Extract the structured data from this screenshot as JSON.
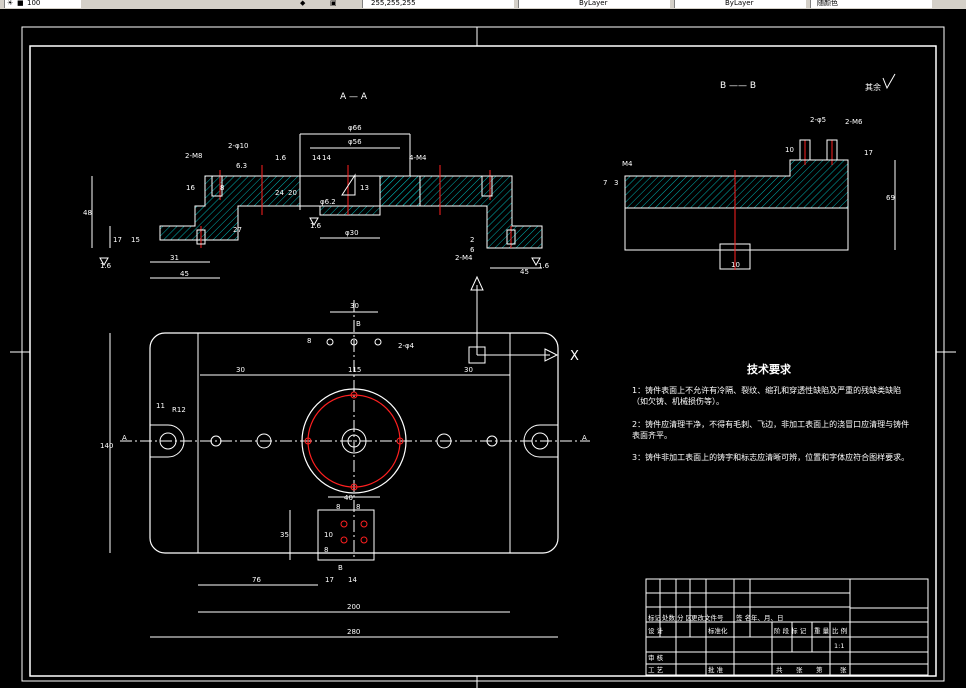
{
  "toolbar": {
    "layer_value": "100",
    "layer_field": "255,255,255",
    "linetype_value": "ByLayer",
    "lineweight_value": "ByLayer",
    "plot_value": "随颜色"
  },
  "views": {
    "section_aa": "A — A",
    "section_bb": "B —— B",
    "surface_note": "其余"
  },
  "dims_aa": {
    "d66": "φ66",
    "d56": "φ56",
    "m8": "2-M8",
    "d10": "2-φ10",
    "r16": "1.6",
    "r63": "6.3",
    "m4a": "4-M4",
    "d14": "14",
    "d16": "16",
    "d48": "48",
    "d17": "17",
    "d15": "15",
    "d27": "27",
    "d31": "31",
    "d45a": "45",
    "d45b": "45",
    "d30": "φ30",
    "d24": "24",
    "d20": "20",
    "m4b": "2-M4",
    "d2": "2",
    "d6": "6",
    "d8": "8",
    "r16b": "1.6",
    "r16c": "1.6",
    "r16d": "1.6",
    "d62": "φ6.2",
    "d14a": "14",
    "d13": "13"
  },
  "dims_bb": {
    "m4": "M4",
    "d5": "2-φ5",
    "m6": "2-M6",
    "d10": "10",
    "d17": "17",
    "d69": "69",
    "d10b": "10",
    "d7": "7",
    "d3": "3"
  },
  "dims_plan": {
    "d30top": "30",
    "b": "B",
    "m4": "2-φ4",
    "d8": "8",
    "d30l": "30",
    "d115": "115",
    "d30r": "30",
    "d11": "11",
    "r12": "R12",
    "d140": "140",
    "a_left": "A",
    "a_right": "A",
    "d40": "40",
    "d8b": "8",
    "d8c": "8",
    "d35": "35",
    "d10": "10",
    "d8d": "8",
    "b2": "B",
    "d76": "76",
    "d17": "17",
    "d14": "14",
    "d200": "200",
    "d280": "280",
    "x": "X"
  },
  "tech": {
    "title": "技术要求",
    "req1": "1：铸件表面上不允许有冷隔、裂纹、缩孔和穿透性缺陷及严重的残缺类缺陷（如欠铸、机械损伤等）。",
    "req2": "2：铸件应清理干净，不得有毛刺、飞边，非加工表面上的浇冒口应清理与铸件表面齐平。",
    "req3": "3：铸件非加工表面上的铸字和标志应清晰可辨，位置和字体应符合图样要求。"
  },
  "titleblock": {
    "h1": "标记",
    "h2": "处数",
    "h3": "分 区",
    "h4": "更改文件号",
    "h5": "签 名",
    "h6": "年、月、日",
    "design": "设 计",
    "std": "标准化",
    "stage": "阶 段 标 记",
    "weight": "重 量",
    "scale": "比 例",
    "scale_value": "1:1",
    "check": "审 核",
    "craft": "工 艺",
    "approve": "批 准",
    "total": "共",
    "sheets": "张",
    "page": "第",
    "sheets2": "张"
  }
}
